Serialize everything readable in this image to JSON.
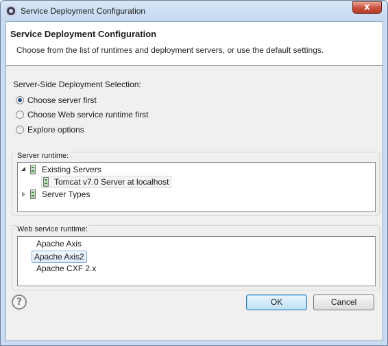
{
  "window": {
    "title": "Service Deployment Configuration",
    "close_glyph": "x"
  },
  "header": {
    "title": "Service Deployment Configuration",
    "description": "Choose from the list of runtimes and deployment servers, or use the default settings."
  },
  "selection": {
    "label": "Server-Side Deployment Selection:",
    "options": [
      {
        "label": "Choose server first",
        "checked": true
      },
      {
        "label": "Choose Web service runtime first",
        "checked": false
      },
      {
        "label": "Explore options",
        "checked": false
      }
    ]
  },
  "server_runtime": {
    "label": "Server runtime:",
    "tree": [
      {
        "label": "Existing Servers",
        "expanded": true,
        "icon": "server-icon"
      },
      {
        "label": "Tomcat v7.0 Server at localhost",
        "selected": true,
        "icon": "server-icon"
      },
      {
        "label": "Server Types",
        "expanded": false,
        "icon": "server-icon"
      }
    ]
  },
  "web_service_runtime": {
    "label": "Web service runtime:",
    "items": [
      {
        "label": "Apache Axis",
        "selected": false
      },
      {
        "label": "Apache Axis2",
        "selected": true
      },
      {
        "label": "Apache CXF 2.x",
        "selected": false
      }
    ]
  },
  "footer": {
    "help_glyph": "?",
    "ok_label": "OK",
    "cancel_label": "Cancel"
  },
  "colors": {
    "titlebar": "#c9dcf1",
    "selection_border": "#84acdd",
    "default_button_border": "#3c7fb1"
  }
}
